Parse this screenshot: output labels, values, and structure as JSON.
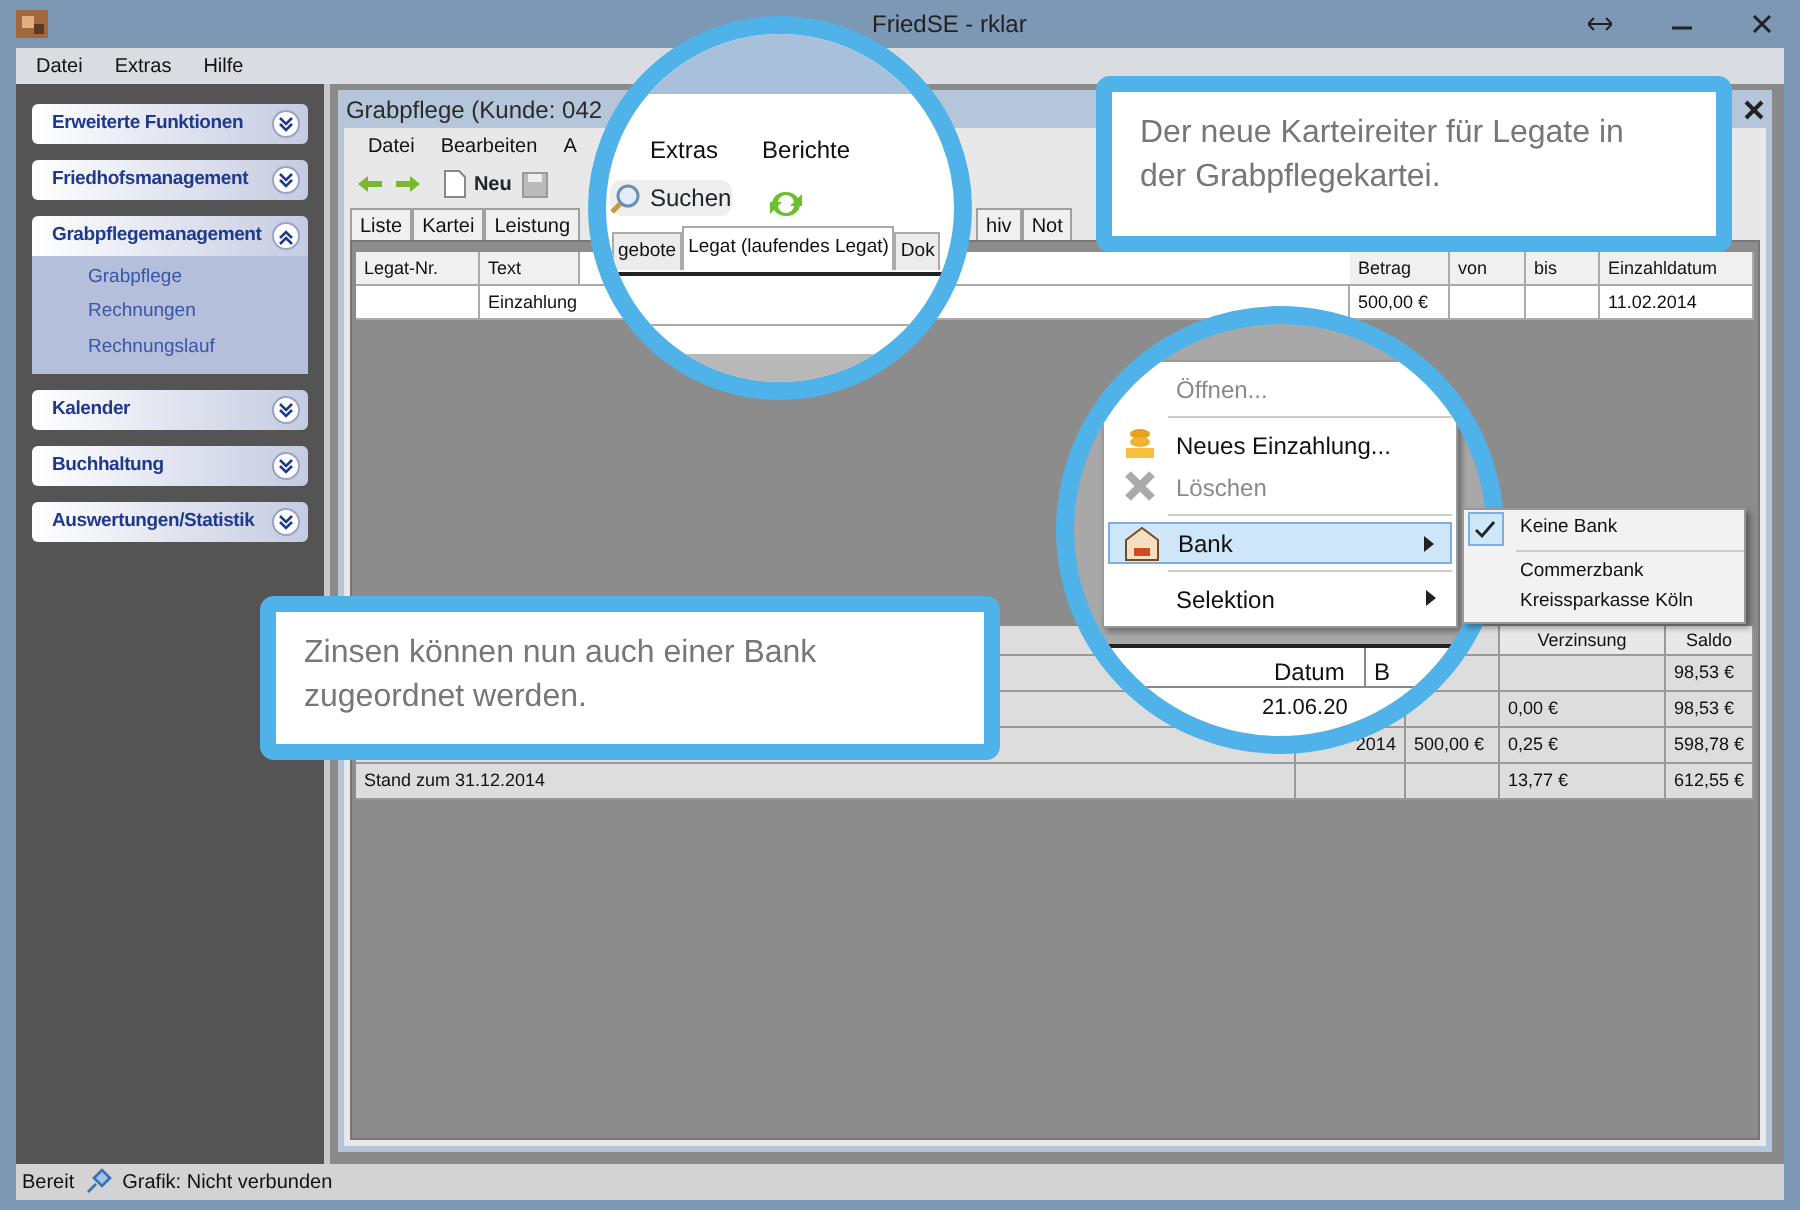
{
  "window": {
    "title": "FriedSE - rklar"
  },
  "menu": [
    {
      "label": "Datei"
    },
    {
      "label": "Extras"
    },
    {
      "label": "Hilfe"
    }
  ],
  "sidebar": {
    "groups": [
      {
        "title": "Erweiterte Funktionen",
        "expanded": false
      },
      {
        "title": "Friedhofsmanagement",
        "expanded": false
      },
      {
        "title": "Grabpflegemanagement",
        "expanded": true,
        "items": [
          "Grabpflege",
          "Rechnungen",
          "Rechnungslauf"
        ]
      },
      {
        "title": "Kalender",
        "expanded": false
      },
      {
        "title": "Buchhaltung",
        "expanded": false
      },
      {
        "title": "Auswertungen/Statistik",
        "expanded": false
      }
    ]
  },
  "child_window": {
    "title": "Grabpflege (Kunde: 042",
    "menu": [
      "Datei",
      "Bearbeiten",
      "A"
    ],
    "toolbar": {
      "new_label": "Neu"
    },
    "tabs_left": [
      "Liste",
      "Kartei",
      "Leistung"
    ],
    "tabs_right": [
      "hiv",
      "Not"
    ],
    "legat_table": {
      "columns": [
        "Legat-Nr.",
        "Text",
        "Betrag",
        "von",
        "bis",
        "Einzahldatum"
      ],
      "rows": [
        {
          "text": "Einzahlung",
          "betrag": "500,00 €",
          "einzahldatum": "11.02.2014"
        }
      ]
    },
    "zins_table": {
      "columns": [
        "Verzinsung",
        "Saldo"
      ],
      "rows": [
        {
          "saldo": "98,53 €"
        },
        {
          "verzinsung": "0,00 €",
          "saldo": "98,53 €"
        },
        {
          "datum": "2014",
          "betrag": "500,00 €",
          "verzinsung": "0,25 €",
          "saldo": "598,78 €"
        },
        {
          "text": "Stand zum 31.12.2014",
          "verzinsung": "13,77 €",
          "saldo": "612,55 €"
        }
      ]
    }
  },
  "status_bar": [
    "Bereit",
    "Grafik: Nicht verbunden"
  ],
  "magnifier_tabs": {
    "menu": [
      "Extras",
      "Berichte"
    ],
    "search_label": "Suchen",
    "tabs": [
      {
        "label": "gebote",
        "selected": false
      },
      {
        "label": "Legat (laufendes Legat)",
        "selected": true
      },
      {
        "label": "Dok",
        "selected": false
      }
    ]
  },
  "magnifier_menu": {
    "context_menu": [
      {
        "label": "Öffnen...",
        "disabled": true,
        "highlighted": false,
        "submenu": false,
        "separator_after": true
      },
      {
        "label": "Neues Einzahlung...",
        "disabled": false,
        "highlighted": false,
        "submenu": false,
        "separator_after": false
      },
      {
        "label": "Löschen",
        "disabled": true,
        "highlighted": false,
        "submenu": false,
        "separator_after": true
      },
      {
        "label": "Bank",
        "disabled": false,
        "highlighted": true,
        "submenu": true,
        "separator_after": true
      },
      {
        "label": "Selektion",
        "disabled": false,
        "highlighted": false,
        "submenu": true,
        "separator_after": false
      }
    ],
    "table_header": "Datum",
    "table_header_2": "B",
    "table_cell": "21.06.20"
  },
  "bank_submenu": [
    {
      "kind": "item",
      "label": "Keine Bank",
      "checked": true
    },
    {
      "kind": "separator"
    },
    {
      "kind": "item",
      "label": "Commerzbank",
      "checked": false
    },
    {
      "kind": "item",
      "label": "Kreissparkasse Köln",
      "checked": false
    }
  ],
  "callouts": [
    {
      "text": "Der neue Karteireiter für Legate in der Grabpflegekartei."
    },
    {
      "text": "Zinsen können nun auch einer Bank zugeordnet werden."
    }
  ]
}
